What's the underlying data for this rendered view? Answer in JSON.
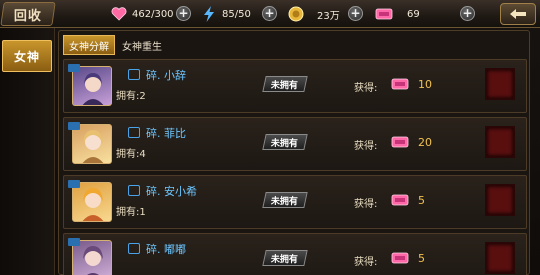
{
  "header": {
    "back_label": "回收",
    "resources": [
      {
        "icon": "heart-icon",
        "value": "462/300",
        "color": "#ff6aa5"
      },
      {
        "icon": "energy-icon",
        "value": "85/50",
        "color": "#58b8ff"
      },
      {
        "icon": "gold-coin-icon",
        "value": "23万",
        "color": "#e8b73a"
      },
      {
        "icon": "pink-gem-icon",
        "value": "69",
        "color": "#ff69a8"
      }
    ],
    "plus_symbol": "+"
  },
  "sidebar": {
    "active_label": "女神"
  },
  "tabs": [
    {
      "label": "女神分解",
      "active": true
    },
    {
      "label": "女神重生",
      "active": false
    }
  ],
  "columns": {
    "owned_prefix": "拥有:",
    "obtain_label": "获得:",
    "status_label": "未拥有"
  },
  "items": [
    {
      "name": "碎. 小辞",
      "owned": "2",
      "obtain": "10",
      "portrait_colors": [
        "#5a4a8a",
        "#c8a0d8"
      ]
    },
    {
      "name": "碎. 菲比",
      "owned": "4",
      "obtain": "20",
      "portrait_colors": [
        "#d8a060",
        "#f8e0a0"
      ]
    },
    {
      "name": "碎. 安小希",
      "owned": "1",
      "obtain": "5",
      "portrait_colors": [
        "#e0a040",
        "#f8d890"
      ]
    },
    {
      "name": "碎. 嘟嘟",
      "owned": "",
      "obtain": "5",
      "portrait_colors": [
        "#7a5a8a",
        "#d0b0d8"
      ]
    }
  ]
}
